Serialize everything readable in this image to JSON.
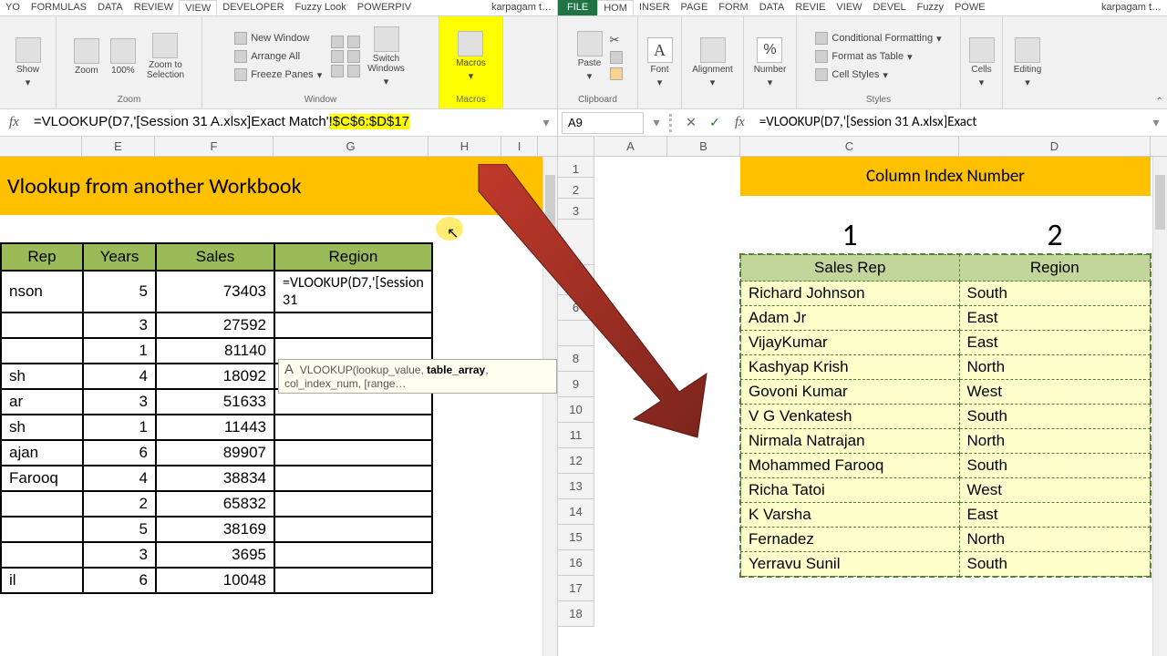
{
  "left": {
    "tabs": [
      "YO",
      "FORMULAS",
      "DATA",
      "REVIEW",
      "VIEW",
      "DEVELOPER",
      "Fuzzy Look",
      "POWERPIV"
    ],
    "activeTab": "VIEW",
    "user": "karpagam t…",
    "ribbon": {
      "zoom": {
        "show": "Show",
        "zoom": "Zoom",
        "hundred": "100%",
        "zts": "Zoom to\nSelection",
        "label": "Zoom"
      },
      "window": {
        "nw": "New Window",
        "aa": "Arrange All",
        "fp": "Freeze Panes",
        "sw": "Switch\nWindows",
        "label": "Window"
      },
      "macros": {
        "btn": "Macros",
        "label": "Macros"
      }
    },
    "formula_plain": "=VLOOKUP(D7,'[Session 31 A.xlsx]Exact Match'",
    "formula_hl": "!$C$6:$D$17",
    "cols": {
      "E": "E",
      "F": "F",
      "G": "G",
      "H": "H",
      "I": "I"
    },
    "title": "Vlookup  from another Workbook",
    "headers": {
      "rep": "Rep",
      "years": "Years",
      "sales": "Sales",
      "region": "Region"
    },
    "rows": [
      {
        "rep": "nson",
        "years": "5",
        "sales": "73403",
        "region": "=VLOOKUP(D7,'[Session 31"
      },
      {
        "rep": "",
        "years": "3",
        "sales": "27592",
        "region": ""
      },
      {
        "rep": "",
        "years": "1",
        "sales": "81140",
        "region": ""
      },
      {
        "rep": "sh",
        "years": "4",
        "sales": "18092",
        "region": ""
      },
      {
        "rep": "ar",
        "years": "3",
        "sales": "51633",
        "region": ""
      },
      {
        "rep": "sh",
        "years": "1",
        "sales": "11443",
        "region": ""
      },
      {
        "rep": "ajan",
        "years": "6",
        "sales": "89907",
        "region": ""
      },
      {
        "rep": "Farooq",
        "years": "4",
        "sales": "38834",
        "region": ""
      },
      {
        "rep": "",
        "years": "2",
        "sales": "65832",
        "region": ""
      },
      {
        "rep": "",
        "years": "5",
        "sales": "38169",
        "region": ""
      },
      {
        "rep": "",
        "years": "3",
        "sales": "3695",
        "region": ""
      },
      {
        "rep": "il",
        "years": "6",
        "sales": "10048",
        "region": ""
      }
    ],
    "hint_pre": "VLOOKUP(lookup_value, ",
    "hint_bold": "table_array",
    "hint_post": ", col_index_num, [range…",
    "hint_A": "A"
  },
  "right": {
    "tabs": [
      "FILE",
      "HOM",
      "INSER",
      "PAGE",
      "FORM",
      "DATA",
      "REVIE",
      "VIEW",
      "DEVEL",
      "Fuzzy",
      "POWE"
    ],
    "activeTab": "HOM",
    "user": "karpagam t…",
    "ribbon": {
      "paste": "Paste",
      "clipboard": "Clipboard",
      "font": "Font",
      "alignment": "Alignment",
      "number": "Number",
      "cf": "Conditional Formatting",
      "fat": "Format as Table",
      "cs": "Cell Styles",
      "styles": "Styles",
      "cells": "Cells",
      "editing": "Editing"
    },
    "namebox": "A9",
    "formula": "=VLOOKUP(D7,'[Session 31 A.xlsx]Exact",
    "cols": {
      "A": "A",
      "B": "B",
      "C": "C",
      "D": "D"
    },
    "rownums": [
      "1",
      "2",
      "3",
      "",
      "",
      "6",
      "",
      "8",
      "9",
      "10",
      "11",
      "12",
      "13",
      "14",
      "15",
      "16",
      "17",
      "18"
    ],
    "band": "Column Index Number",
    "num1": "1",
    "num2": "2",
    "th1": "Sales Rep",
    "th2": "Region",
    "data": [
      {
        "c": "Richard Johnson",
        "d": "South"
      },
      {
        "c": "Adam Jr",
        "d": "East"
      },
      {
        "c": "VijayKumar",
        "d": "East"
      },
      {
        "c": "Kashyap Krish",
        "d": "North"
      },
      {
        "c": "Govoni Kumar",
        "d": "West"
      },
      {
        "c": "V G Venkatesh",
        "d": "South"
      },
      {
        "c": "Nirmala Natrajan",
        "d": "North"
      },
      {
        "c": "Mohammed Farooq",
        "d": "South"
      },
      {
        "c": "Richa Tatoi",
        "d": "West"
      },
      {
        "c": "K Varsha",
        "d": "East"
      },
      {
        "c": "Fernadez",
        "d": "North"
      },
      {
        "c": "Yerravu Sunil",
        "d": "South"
      }
    ]
  },
  "icons": {
    "ok": "✓",
    "cancel": "✕",
    "dd": "▾",
    "caret": "⌃",
    "cut": "✂"
  }
}
